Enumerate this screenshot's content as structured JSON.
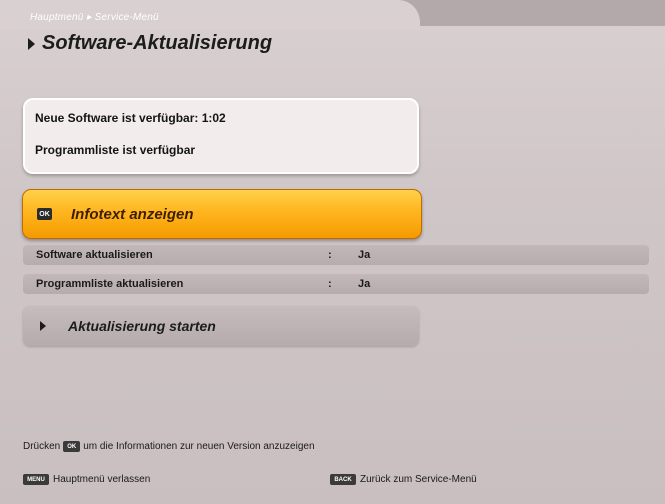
{
  "header": {
    "breadcrumb": "Hauptmenü ▸ Service-Menü",
    "title": "Software-Aktualisierung"
  },
  "info": {
    "line1": "Neue Software ist verfügbar: 1:02",
    "line2": "Programmliste ist verfügbar"
  },
  "actions": {
    "ok_key": "OK",
    "infotext_label": "Infotext anzeigen",
    "start_label": "Aktualisierung starten"
  },
  "settings": [
    {
      "name": "Software aktualisieren",
      "separator": ":",
      "value": "Ja"
    },
    {
      "name": "Programmliste aktualisieren",
      "separator": ":",
      "value": "Ja"
    }
  ],
  "footer": {
    "hint_before": "Drücken",
    "hint_key": "OK",
    "hint_after": "um die Informationen zur neuen Version anzuzeigen",
    "menu_key": "MENU",
    "menu_label": "Hauptmenü verlassen",
    "back_key": "BACK",
    "back_label": "Zurück zum Service-Menü"
  },
  "colors": {
    "accent": "#ffb51f",
    "panel": "#cfc6c7"
  }
}
